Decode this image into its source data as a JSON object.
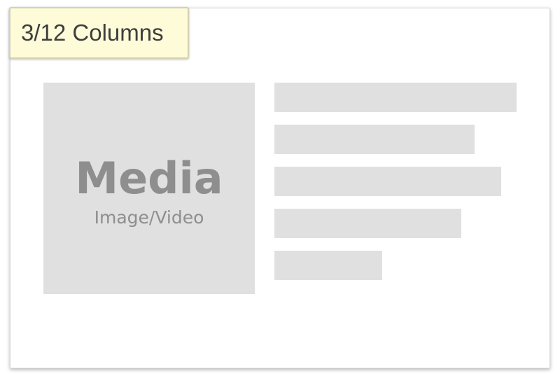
{
  "badge": {
    "label": "3/12 Columns"
  },
  "media": {
    "title": "Media",
    "subtitle": "Image/Video"
  },
  "text_placeholders": {
    "count": 5,
    "fill_color": "#e0e0e0"
  },
  "colors": {
    "badge_background": "#fefbd8",
    "placeholder_gray": "#e0e0e0",
    "media_text": "#8e8e8e"
  }
}
